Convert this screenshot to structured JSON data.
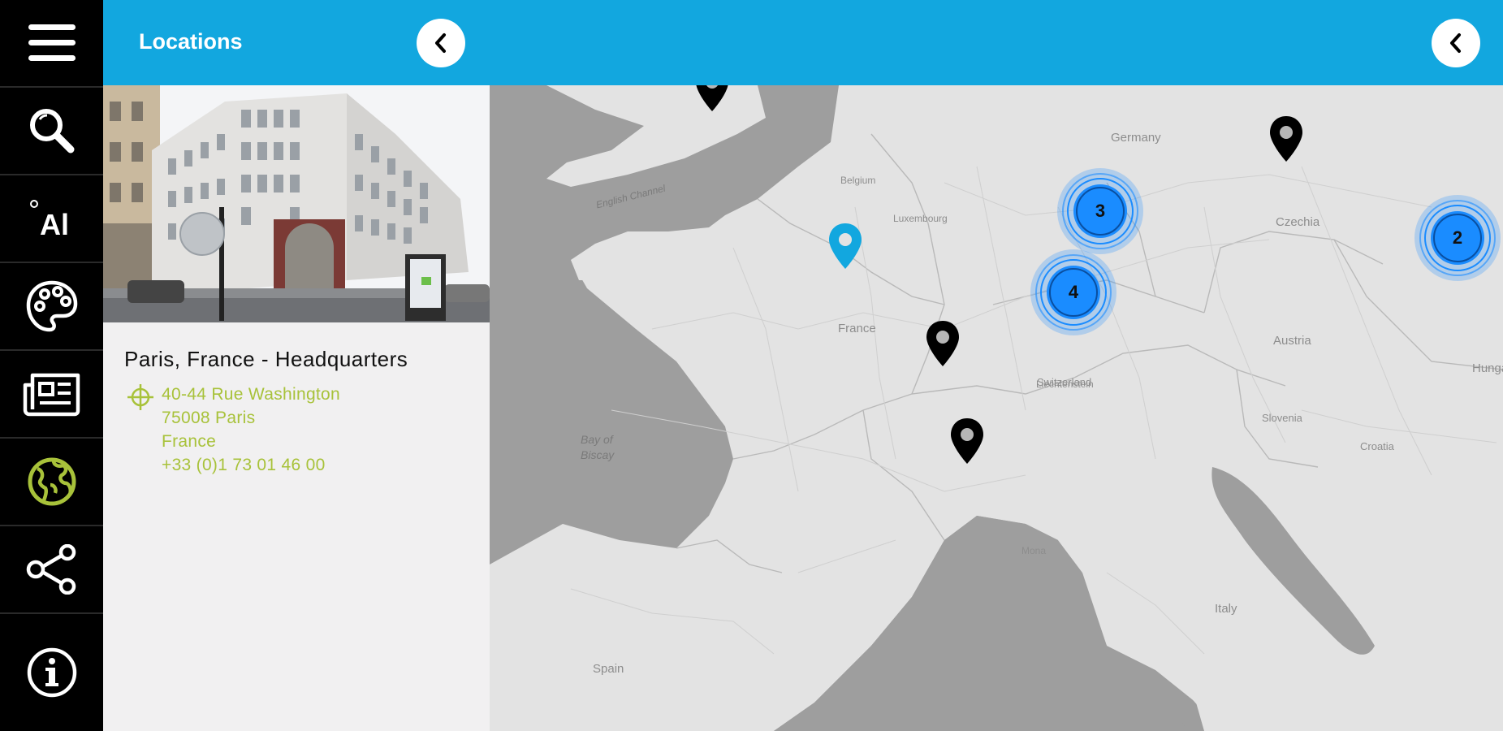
{
  "app": {
    "header_title": "Locations"
  },
  "rail": {
    "items": [
      {
        "icon": "menu-icon"
      },
      {
        "icon": "search-icon"
      },
      {
        "icon": "text-size-icon",
        "label": "Al"
      },
      {
        "icon": "palette-icon"
      },
      {
        "icon": "news-icon"
      },
      {
        "icon": "globe-icon",
        "active": true
      },
      {
        "icon": "share-icon"
      },
      {
        "icon": "info-icon"
      }
    ],
    "active_color": "#a8c23a"
  },
  "location": {
    "name": "Paris, France - Headquarters",
    "address_line1": "40-44 Rue Washington",
    "address_line2": "75008 Paris",
    "address_line3": "France",
    "phone": "+33 (0)1 73 01 46 00"
  },
  "map": {
    "labels": {
      "germany": "Germany",
      "france": "France",
      "switzerland": "Switzerland",
      "austria": "Austria",
      "czechia": "Czechia",
      "italy": "Italy",
      "spain": "Spain",
      "belgium": "Belgium",
      "luxembourg": "Luxembourg",
      "liechtenstein": "Liechtenstein",
      "slovenia": "Slovenia",
      "croatia": "Croatia",
      "hungary": "Hungary",
      "monaco": "Mona",
      "bay_of_biscay_1": "Bay of",
      "bay_of_biscay_2": "Biscay",
      "english_channel": "English Channel"
    },
    "clusters": [
      {
        "count": "3"
      },
      {
        "count": "4"
      },
      {
        "count": "2"
      }
    ],
    "colors": {
      "accent": "#12a7df",
      "cluster": "#1a8cff",
      "selected_pin": "#12a7df",
      "pin": "#000000"
    }
  }
}
